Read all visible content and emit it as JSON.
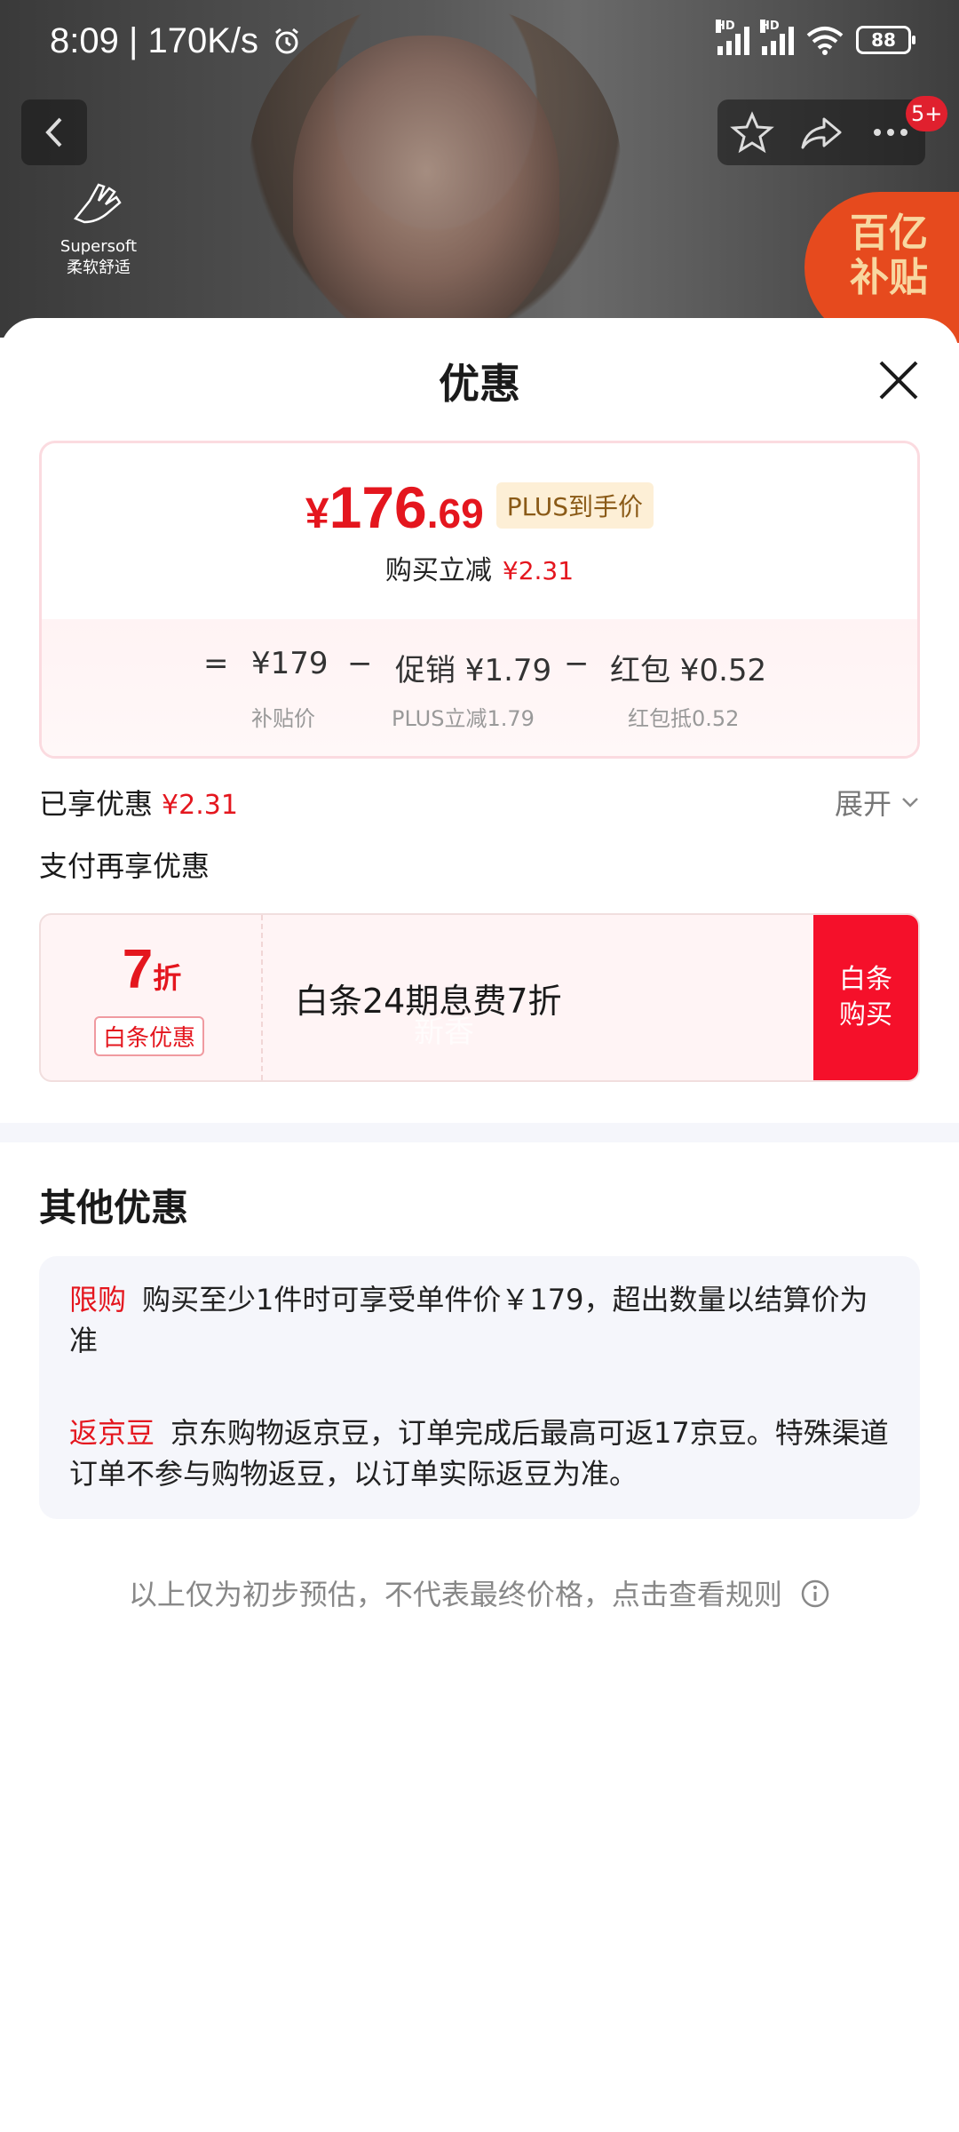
{
  "status_bar": {
    "time": "8:09 | 170K/s",
    "hd": "HD",
    "battery": "88"
  },
  "brand": {
    "logo_line1": "Supersoft",
    "logo_line2": "柔软舒适"
  },
  "subsidy_badge": {
    "line1": "百亿",
    "line2": "补贴"
  },
  "nav": {
    "badge": "5+"
  },
  "sheet": {
    "title": "优惠"
  },
  "price": {
    "yen": "¥",
    "int": "176",
    "dec": ".69",
    "tag": "PLUS到手价",
    "save_label": "购买立减",
    "save_amount": "¥2.31"
  },
  "calc": {
    "equals": "=",
    "base": "¥179",
    "base_sub": "补贴价",
    "minus": "−",
    "promo": "促销 ¥1.79",
    "promo_sub": "PLUS立减1.79",
    "redpacket": "红包 ¥0.52",
    "redpacket_sub": "红包抵0.52"
  },
  "enjoyed": {
    "label": "已享优惠",
    "amount": "¥2.31",
    "expand": "展开"
  },
  "pay": {
    "title": "支付再享优惠",
    "discount_num": "7",
    "discount_unit": "折",
    "tag": "白条优惠",
    "desc": "白条24期息费7折",
    "watermark": "新香",
    "button_line1": "白条",
    "button_line2": "购买"
  },
  "other": {
    "title": "其他优惠",
    "items": [
      {
        "tag": "限购",
        "text": "购买至少1件时可享受单件价￥179，超出数量以结算价为准"
      },
      {
        "tag": "返京豆",
        "text": "京东购物返京豆，订单完成后最高可返17京豆。特殊渠道订单不参与购物返豆，以订单实际返豆为准。"
      }
    ]
  },
  "footer": {
    "note": "以上仅为初步预估，不代表最终价格，点击查看规则"
  },
  "colors": {
    "accent_red": "#e4161e",
    "button_red": "#f5102a",
    "plus_bg": "#fdefd6"
  }
}
